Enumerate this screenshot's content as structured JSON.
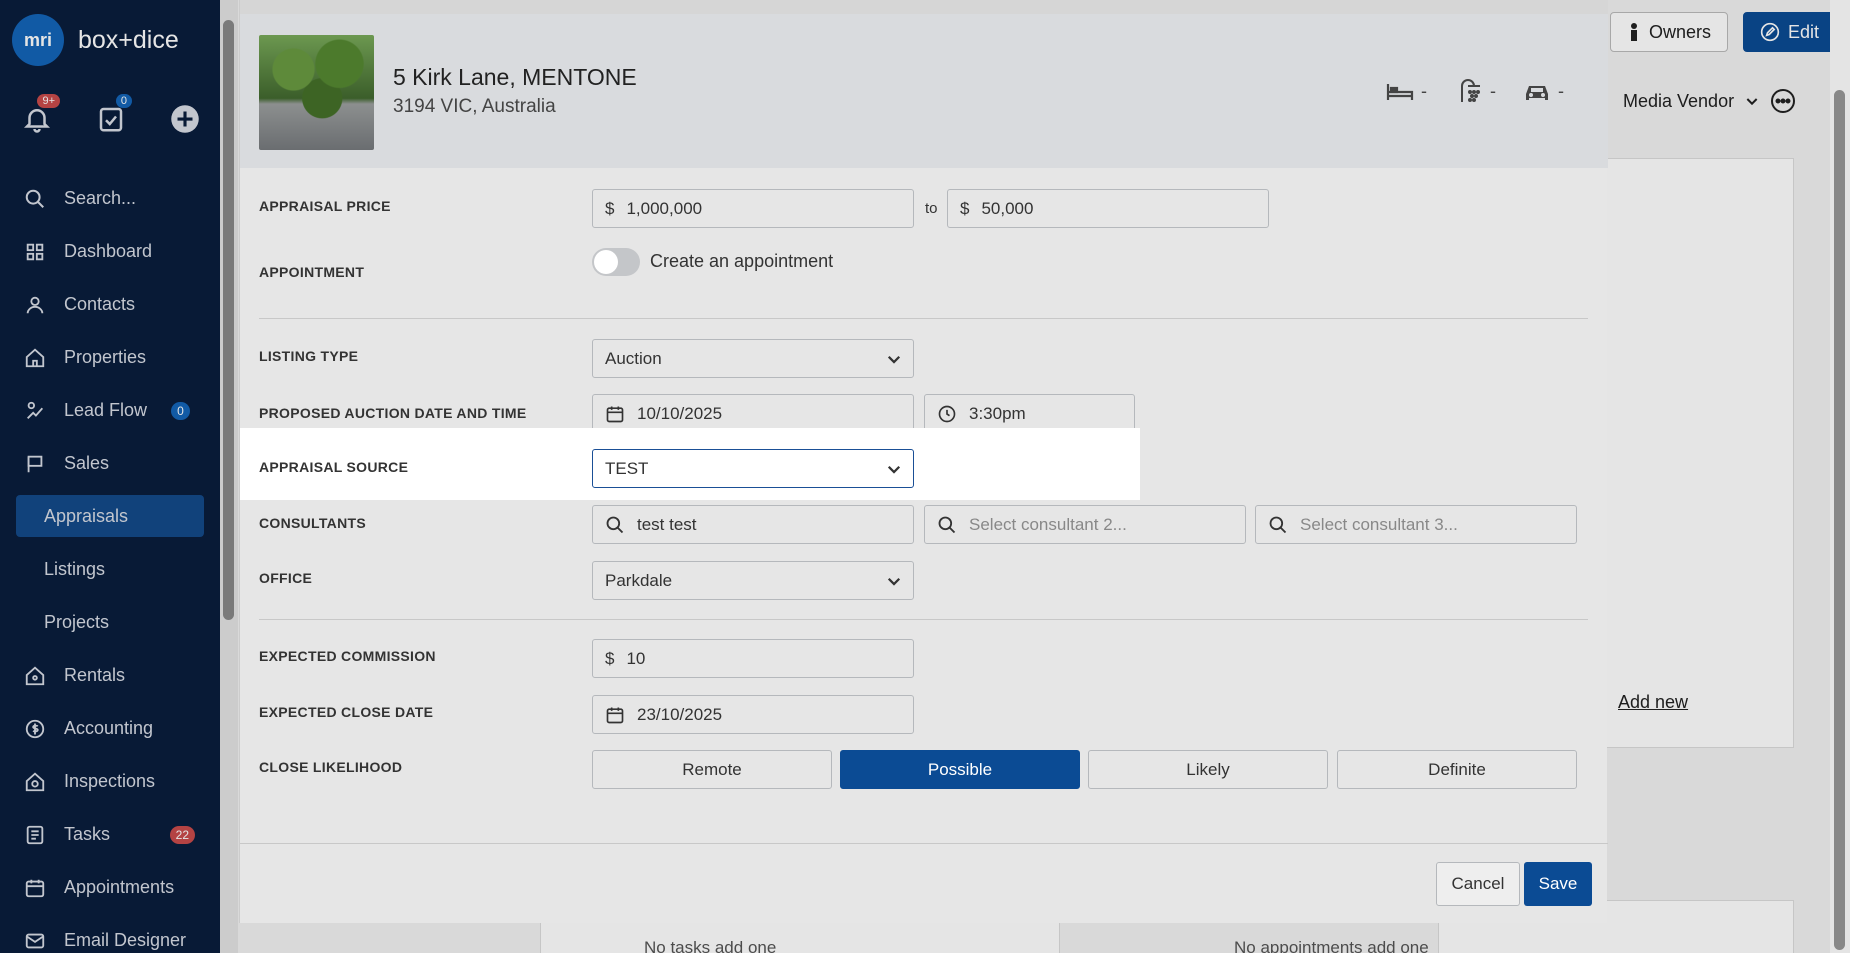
{
  "app": {
    "brand": "box+dice",
    "logo_text": "mri"
  },
  "sidebar": {
    "notifications_badge": "9+",
    "tasks_badge": "0",
    "items": [
      {
        "label": "Search...",
        "icon": "search-icon"
      },
      {
        "label": "Dashboard",
        "icon": "dashboard-icon"
      },
      {
        "label": "Contacts",
        "icon": "contact-icon"
      },
      {
        "label": "Properties",
        "icon": "home-icon"
      },
      {
        "label": "Lead Flow",
        "icon": "lead-flow-icon",
        "count": "0"
      },
      {
        "label": "Sales",
        "icon": "sales-icon"
      },
      {
        "label": "Appraisals"
      },
      {
        "label": "Listings"
      },
      {
        "label": "Projects"
      },
      {
        "label": "Rentals",
        "icon": "rentals-icon"
      },
      {
        "label": "Accounting",
        "icon": "accounting-icon"
      },
      {
        "label": "Inspections",
        "icon": "inspections-icon"
      },
      {
        "label": "Tasks",
        "icon": "tasks-icon",
        "count": "22"
      },
      {
        "label": "Appointments",
        "icon": "appointments-icon"
      },
      {
        "label": "Email Designer",
        "icon": "email-icon"
      }
    ]
  },
  "background": {
    "owners_label": "Owners",
    "edit_label": "Edit",
    "media_vendor_label": "Media Vendor",
    "add_new_label": "Add new",
    "no_tasks_label": "No tasks add one",
    "no_appointments_label": "No appointments add one"
  },
  "modal": {
    "property": {
      "address_line1": "5 Kirk Lane, MENTONE",
      "address_line2": "3194 VIC, Australia",
      "beds": "-",
      "baths": "-",
      "cars": "-"
    },
    "appraisal_price": {
      "label": "APPRAISAL PRICE",
      "currency": "$",
      "from": "1,000,000",
      "to_label": "to",
      "to": "50,000"
    },
    "appointment": {
      "label": "APPOINTMENT",
      "toggle_label": "Create an appointment",
      "enabled": false
    },
    "listing_type": {
      "label": "LISTING TYPE",
      "value": "Auction"
    },
    "auction": {
      "label": "PROPOSED AUCTION DATE AND TIME",
      "date": "10/10/2025",
      "time": "3:30pm"
    },
    "appraisal_source": {
      "label": "APPRAISAL SOURCE",
      "value": "TEST"
    },
    "consultants": {
      "label": "CONSULTANTS",
      "c1": "test test",
      "c2_placeholder": "Select consultant 2...",
      "c3_placeholder": "Select consultant 3..."
    },
    "office": {
      "label": "OFFICE",
      "value": "Parkdale"
    },
    "commission": {
      "label": "EXPECTED COMMISSION",
      "currency": "$",
      "value": "10"
    },
    "close_date": {
      "label": "EXPECTED CLOSE DATE",
      "value": "23/10/2025"
    },
    "close_likelihood": {
      "label": "CLOSE LIKELIHOOD",
      "options": [
        "Remote",
        "Possible",
        "Likely",
        "Definite"
      ],
      "selected": "Possible"
    },
    "cancel_label": "Cancel",
    "save_label": "Save"
  },
  "colors": {
    "primary": "#0b4b94",
    "sidebar_bg": "#0a1d3d",
    "badge_red": "#c94b4b"
  }
}
